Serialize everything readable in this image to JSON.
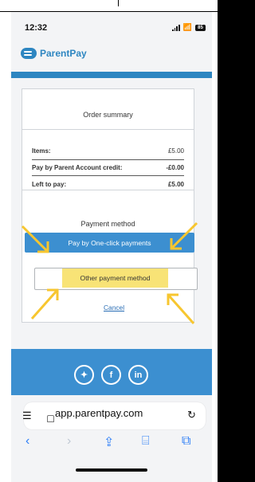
{
  "status_bar": {
    "time": "12:32",
    "battery": "85"
  },
  "app": {
    "brand": "ParentPay"
  },
  "order_summary": {
    "title": "Order summary",
    "rows": [
      {
        "label": "Items:",
        "value": "£5.00"
      },
      {
        "label": "Pay by Parent Account credit:",
        "value": "-£0.00"
      },
      {
        "label": "Left to pay:",
        "value": "£5.00"
      }
    ]
  },
  "payment_method": {
    "title": "Payment method",
    "primary_button": "Pay by One-click payments",
    "other_button": "Other payment method",
    "cancel": "Cancel"
  },
  "footer": {
    "icons": [
      "twitter-icon",
      "facebook-icon",
      "linkedin-icon"
    ]
  },
  "browser": {
    "url": "app.parentpay.com"
  },
  "colors": {
    "primary": "#3c8fd0",
    "highlight": "#f8e26f",
    "arrow": "#f7c62f"
  }
}
